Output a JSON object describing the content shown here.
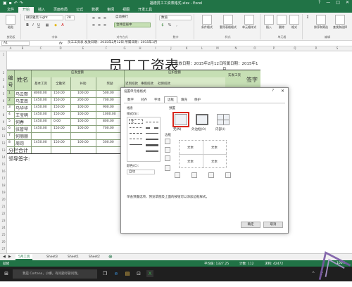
{
  "window": {
    "title": "福德员工工资表格式.xlsx - Excel",
    "controls": [
      "?",
      "—",
      "□",
      "✕"
    ]
  },
  "ribbon_tabs": [
    "文件",
    "开始",
    "插入",
    "页面布局",
    "公式",
    "数据",
    "审阅",
    "视图",
    "开发工具"
  ],
  "ribbon": {
    "clipboard_label": "剪贴板",
    "paste_label": "粘贴",
    "font_label": "字体",
    "font_name": "微软雅黑 Light",
    "font_size": "28",
    "align_label": "对齐方式",
    "wrap_label": "自动换行",
    "merge_label": "合并后居中",
    "number_label": "数字",
    "number_format": "数值",
    "styles_label": "样式",
    "cond_format": "条件格式",
    "table_format": "套用表格格式",
    "cell_styles": "单元格样式",
    "cells_label": "单元格",
    "insert": "插入",
    "delete": "删除",
    "format": "格式",
    "edit_label": "编辑",
    "sort_filter": "排序和筛选",
    "find_select": "查找和选择"
  },
  "formula_bar": {
    "name_box": "A1",
    "fx": "fx",
    "formula": "员工工资表   发放日期：2015年2月12日   所属日期：2015年1月"
  },
  "columns": [
    "A",
    "B",
    "C",
    "D",
    "E",
    "F",
    "G",
    "H",
    "I",
    "J",
    "K",
    "L",
    "M",
    "N",
    "O",
    "P",
    "Q",
    "R",
    "S"
  ],
  "rows": [
    "1",
    "2",
    "3",
    "4",
    "5",
    "6",
    "7",
    "8",
    "9",
    "10",
    "11",
    "12",
    "13",
    "14",
    "15",
    "16",
    "17",
    "18",
    "19",
    "20",
    "21",
    "22",
    "23",
    "24",
    "25",
    "26",
    "27",
    "28",
    "29",
    "30"
  ],
  "sheet": {
    "title": "员工工资表",
    "issue_date": "发放日期：2015年2月12日",
    "period": "所属日期：2015年1月",
    "col_no": "编号",
    "col_name": "姓名",
    "group_payable": "应发金额",
    "group_deduct": "应扣金额",
    "sub_headers": [
      "基本工资",
      "全勤奖",
      "补助",
      "奖励",
      "迟到扣款",
      "事假扣款",
      "社保扣款"
    ],
    "col_actual": "实发工资",
    "col_sign": "签字",
    "rows": [
      {
        "no": "1",
        "name": "马云熙",
        "v": [
          "8000.00",
          "150.00",
          "100.00",
          "500.00"
        ]
      },
      {
        "no": "2",
        "name": "马亚南",
        "v": [
          "1450.00",
          "150.00",
          "200.00",
          "700.00"
        ]
      },
      {
        "no": "3",
        "name": "马华华",
        "v": [
          "1450.00",
          "150.00",
          "100.00",
          "900.00"
        ]
      },
      {
        "no": "4",
        "name": "王宝明",
        "v": [
          "1450.00",
          "150.00",
          "100.00",
          "1000.00"
        ]
      },
      {
        "no": "5",
        "name": "何春",
        "v": [
          "1450.00",
          "0.00",
          "100.00",
          "800.00"
        ]
      },
      {
        "no": "6",
        "name": "张管琴",
        "v": [
          "1450.00",
          "150.00",
          "100.00",
          "700.00"
        ]
      },
      {
        "no": "7",
        "name": "何丽丽",
        "v": [
          "",
          "",
          "",
          ""
        ]
      },
      {
        "no": "8",
        "name": "周司",
        "v": [
          "1450.00",
          "150.00",
          "100.00",
          "500.00"
        ]
      }
    ],
    "subtotal": "分栏合计",
    "leader_sign": "领导签字:"
  },
  "dialog": {
    "title": "设置单元格格式",
    "help": "?",
    "close": "✕",
    "tabs": [
      "数字",
      "对齐",
      "字体",
      "边框",
      "填充",
      "保护"
    ],
    "active_tab": "边框",
    "line_label": "线条",
    "style_label": "样式(S):",
    "none_label": "无",
    "color_label": "颜色(C):",
    "color_value": "自动",
    "presets_label": "预置",
    "preset_none": "无(N)",
    "preset_outline": "外边框(O)",
    "preset_inside": "内部(I)",
    "border_label": "边框",
    "preview_text": "文本",
    "hint": "单击预置选项、预览草图及上面的按钮可以添加边框样式。",
    "ok": "确定",
    "cancel": "取消",
    "highlight_color": "#d9261c"
  },
  "sheet_tabs": [
    "5月工资",
    "Sheet3",
    "Sheet1",
    "Sheet2"
  ],
  "status": {
    "ready": "就绪",
    "average": "平均值: 1327.25",
    "count": "计数: 112",
    "sum": "求和: 42472",
    "zoom": "100%"
  },
  "taskbar": {
    "search": "我是 Cortana，小娜。有问题尽管问我。"
  },
  "colors": {
    "excel_green": "#217346",
    "header_fill": "#c6dfb4"
  }
}
